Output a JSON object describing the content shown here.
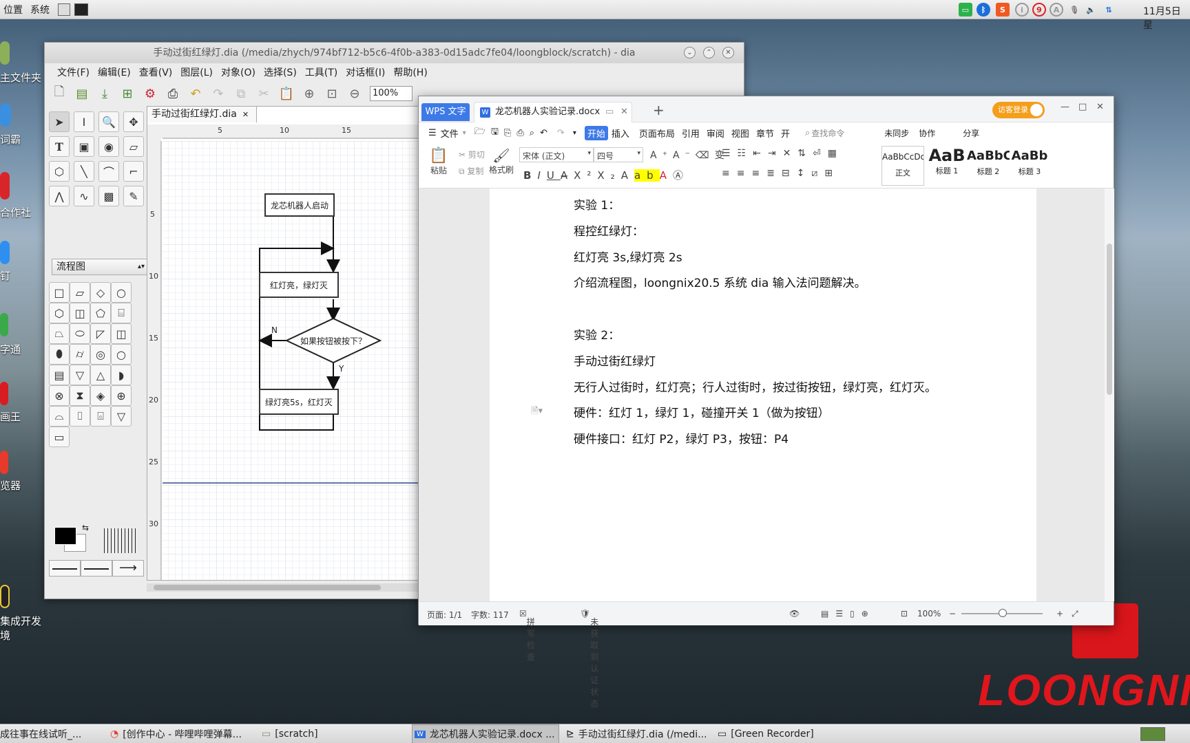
{
  "top_panel": {
    "menu": [
      "位置",
      "系统"
    ],
    "clock": "11月5日星",
    "tray_icons": [
      "camera-icon",
      "bluetooth-icon",
      "s-icon",
      "i-icon",
      "9-icon",
      "a-icon",
      "mic-icon",
      "volume-icon",
      "network-icon"
    ]
  },
  "desktop": {
    "icons": [
      {
        "label": "主文件夹"
      },
      {
        "label": "词霸"
      },
      {
        "label": "合作社"
      },
      {
        "label": "钉"
      },
      {
        "label": "字通"
      },
      {
        "label": "画王"
      },
      {
        "label": "览器"
      },
      {
        "label": "集成开发"
      },
      {
        "label": "境"
      }
    ],
    "logo": "LOONGNI"
  },
  "dia": {
    "title": "手动过街红绿灯.dia (/media/zhych/974bf712-b5c6-4f0b-a383-0d15adc7fe04/loongblock/scratch) - dia",
    "menu": [
      "文件(F)",
      "编辑(E)",
      "查看(V)",
      "图层(L)",
      "对象(O)",
      "选择(S)",
      "工具(T)",
      "对话框(I)",
      "帮助(H)"
    ],
    "zoom": "100%",
    "sheet": "流程图",
    "tab": "手动过街红绿灯.dia",
    "ruler_top": [
      "5",
      "10",
      "15"
    ],
    "ruler_left": [
      "5",
      "10",
      "15",
      "20",
      "25",
      "30"
    ],
    "flow": {
      "start": "龙芯机器人启动",
      "step1": "红灯亮，绿灯灭",
      "decision": "如果按钮被按下？",
      "no": "N",
      "yes": "Y",
      "step2": "绿灯亮5s，红灯灭"
    }
  },
  "wps": {
    "app_tab": "WPS 文字",
    "doc_tab": "龙芯机器人实验记录.docx",
    "login": "访客登录",
    "menu_file": "文件",
    "tabs": [
      "开始",
      "插入",
      "页面布局",
      "引用",
      "审阅",
      "视图",
      "章节",
      "开"
    ],
    "search": "查找命令",
    "right_tools": [
      "未同步",
      "协作",
      "分享"
    ],
    "ribbon": {
      "paste": "粘贴",
      "cut": "剪切",
      "copy": "复制",
      "format_painter": "格式刷",
      "font": "宋体 (正文)",
      "size": "四号",
      "styles": [
        {
          "preview": "AaBbCcDd",
          "name": "正文"
        },
        {
          "preview": "AaB",
          "name": "标题 1"
        },
        {
          "preview": "AaBbC",
          "name": "标题 2"
        },
        {
          "preview": "AaBb",
          "name": "标题 3"
        }
      ]
    },
    "paragraphs": [
      "实验 1：",
      "程控红绿灯：",
      "红灯亮 3s,绿灯亮 2s",
      "介绍流程图，loongnix20.5 系统 dia 输入法问题解决。",
      "",
      "实验 2：",
      "手动过街红绿灯",
      "无行人过街时，红灯亮；行人过街时，按过街按钮，绿灯亮，红灯灭。",
      "硬件：红灯 1，绿灯 1，碰撞开关 1（做为按钮）",
      "硬件接口：红灯 P2，绿灯 P3，按钮：P4"
    ],
    "status": {
      "page": "页面: 1/1",
      "words": "字数: 117",
      "spell": "拼写检查",
      "auth": "未获取到认证状态",
      "zoom": "100%"
    }
  },
  "taskbar": {
    "items": [
      "成往事在线试听_...",
      "[创作中心 - 哔哩哔哩弹幕...",
      "[scratch]",
      "龙芯机器人实验记录.docx ...",
      "手动过街红绿灯.dia (/medi...",
      "[Green Recorder]"
    ]
  }
}
